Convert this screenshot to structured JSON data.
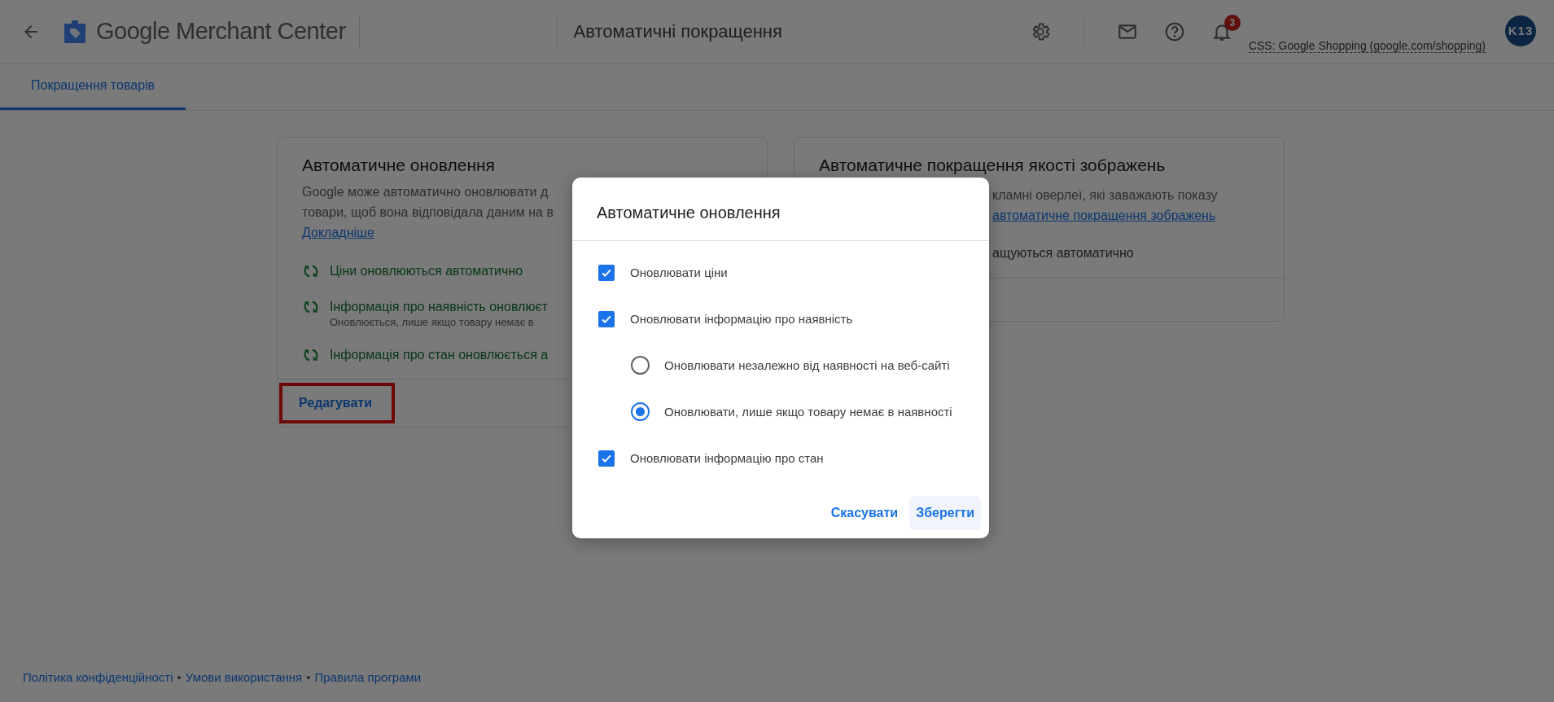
{
  "header": {
    "logo_text": "Google Merchant Center",
    "page_title": "Автоматичні покращення",
    "notification_count": "3",
    "account_label": "CSS: Google Shopping (google.com/shopping)",
    "avatar_initials": "K13"
  },
  "tabs": [
    {
      "label": "Покращення товарів",
      "selected": true
    }
  ],
  "left_card": {
    "title": "Автоматичне оновлення",
    "description_lines": [
      "Google може автоматично оновлювати д",
      "товари, щоб вона відповідала даним на в"
    ],
    "link": "Докладніше",
    "items": [
      {
        "text": "Ціни оновлюються автоматично"
      },
      {
        "text": "Інформація про наявність оновлюєт",
        "subtext": "Оновлюється, лише якщо товару немає в"
      },
      {
        "text": "Інформація про стан оновлюється а"
      }
    ],
    "edit_button": {
      "label": "Редагувати",
      "highlighted": true
    }
  },
  "right_card": {
    "title": "Автоматичне покращення якості зображень",
    "description_line": "кламні оверлеї, які заважають показу",
    "link": "автоматичне покращення зображень",
    "status_text": "ащуються автоматично"
  },
  "dialog": {
    "title": "Автоматичне оновлення",
    "options": [
      {
        "kind": "checkbox",
        "label": "Оновлювати ціни",
        "checked": true
      },
      {
        "kind": "checkbox",
        "label": "Оновлювати інформацію про наявність",
        "checked": true,
        "children": [
          {
            "kind": "radio",
            "label": "Оновлювати незалежно від наявності на веб-сайті",
            "selected": false
          },
          {
            "kind": "radio",
            "label": "Оновлювати, лише якщо товару немає в наявності",
            "selected": true
          }
        ]
      },
      {
        "kind": "checkbox",
        "label": "Оновлювати інформацію про стан",
        "checked": true
      }
    ],
    "cancel_button": "Скасувати",
    "save_button": "Зберегти"
  },
  "footer": {
    "links": [
      "Політика конфіденційності",
      "Умови використання",
      "Правила програми"
    ],
    "separator": "•"
  }
}
